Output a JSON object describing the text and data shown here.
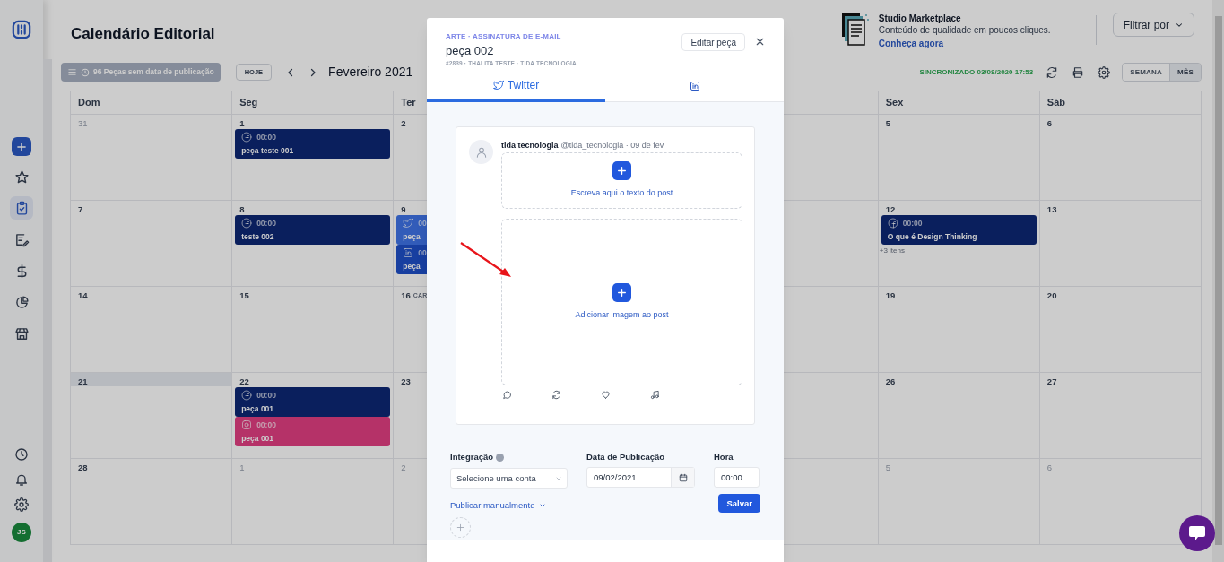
{
  "sidebar": {
    "nav_items": [
      {
        "selected": false
      },
      {
        "selected": true
      },
      {
        "selected": false
      },
      {
        "selected": false
      },
      {
        "selected": false
      },
      {
        "selected": false
      }
    ],
    "avatar": "JS"
  },
  "header": {
    "title": "Calendário Editorial",
    "promo": {
      "title": "Studio Marketplace",
      "subtitle": "Conteúdo de qualidade em poucos cliques.",
      "link": "Conheça agora"
    },
    "filter_button": "Filtrar por"
  },
  "toolbar": {
    "unscheduled_button": "96 Peças sem data de publicação",
    "today_button": "HOJE",
    "month": "Fevereiro 2021",
    "sync_status": "SINCRONIZADO 03/08/2020 17:53",
    "view_toggle": [
      {
        "label": "SEMANA",
        "selected": false
      },
      {
        "label": "MÊS",
        "selected": true
      }
    ]
  },
  "calendar": {
    "weekdays": [
      "Dom",
      "Seg",
      "Ter",
      "Sex",
      "Sáb"
    ],
    "weeks": [
      {
        "days": [
          {
            "date": "31",
            "muted": true,
            "highlighted": false
          },
          {
            "date": "1",
            "muted": false,
            "highlighted": false,
            "events": [
              {
                "kind": "facebook",
                "time": "00:00",
                "title": "peça teste 001"
              }
            ]
          },
          {
            "date": "2",
            "muted": false,
            "highlighted": false
          },
          {
            "date": "5",
            "muted": false,
            "highlighted": false
          },
          {
            "date": "6",
            "muted": false,
            "highlighted": false
          }
        ]
      },
      {
        "days": [
          {
            "date": "7",
            "muted": false,
            "highlighted": false
          },
          {
            "date": "8",
            "muted": false,
            "highlighted": false,
            "events": [
              {
                "kind": "facebook",
                "time": "00:00",
                "title": "teste 002"
              }
            ]
          },
          {
            "date": "9",
            "muted": false,
            "highlighted": false,
            "events": [
              {
                "kind": "twitter",
                "time": "00",
                "title": "peça"
              },
              {
                "kind": "linkedin",
                "time": "00",
                "title": "peça"
              }
            ]
          },
          {
            "date": "12",
            "muted": false,
            "highlighted": false,
            "events": [
              {
                "kind": "facebook",
                "time": "00:00",
                "title": "O que é Design Thinking"
              }
            ],
            "more": "+3 itens"
          },
          {
            "date": "13",
            "muted": false,
            "highlighted": false
          }
        ]
      },
      {
        "days": [
          {
            "date": "14",
            "muted": false,
            "highlighted": false
          },
          {
            "date": "15",
            "muted": false,
            "highlighted": false
          },
          {
            "date": "16",
            "muted": false,
            "highlighted": false,
            "holiday": "CAR"
          },
          {
            "date": "19",
            "muted": false,
            "highlighted": false
          },
          {
            "date": "20",
            "muted": false,
            "highlighted": false
          }
        ]
      },
      {
        "days": [
          {
            "date": "21",
            "muted": false,
            "highlighted": true
          },
          {
            "date": "22",
            "muted": false,
            "highlighted": false,
            "events": [
              {
                "kind": "facebook",
                "time": "00:00",
                "title": "peça 001"
              },
              {
                "kind": "instagram",
                "time": "00:00",
                "title": "peça 001"
              }
            ]
          },
          {
            "date": "23",
            "muted": false,
            "highlighted": false
          },
          {
            "date": "26",
            "muted": false,
            "highlighted": false
          },
          {
            "date": "27",
            "muted": false,
            "highlighted": false
          }
        ]
      },
      {
        "days": [
          {
            "date": "28",
            "muted": false,
            "highlighted": false
          },
          {
            "date": "1",
            "muted": true,
            "highlighted": false
          },
          {
            "date": "2",
            "muted": true,
            "highlighted": false
          },
          {
            "date": "5",
            "muted": true,
            "highlighted": false
          },
          {
            "date": "6",
            "muted": true,
            "highlighted": false
          }
        ]
      }
    ]
  },
  "modal": {
    "category": "ARTE · ASSINATURA DE E-MAIL",
    "title": "peça 002",
    "meta": "#2839 · THALITA TESTE · TIDA TECNOLOGIA",
    "edit_button": "Editar peça",
    "tabs": [
      {
        "kind": "twitter",
        "label": "Twitter",
        "selected": true
      },
      {
        "kind": "linkedin",
        "selected": false
      }
    ],
    "post": {
      "author": "tida tecnologia",
      "handle": "@tida_tecnologia · 09 de fev",
      "text_prompt": "Escreva aqui o texto do post",
      "image_prompt": "Adicionar imagem ao post"
    },
    "form": {
      "integration_label": "Integração",
      "account_select": "Selecione uma conta",
      "date_label": "Data de Publicação",
      "date_value": "09/02/2021",
      "time_label": "Hora",
      "time_value": "00:00",
      "manual_link": "Publicar manualmente",
      "save_button": "Salvar"
    }
  }
}
